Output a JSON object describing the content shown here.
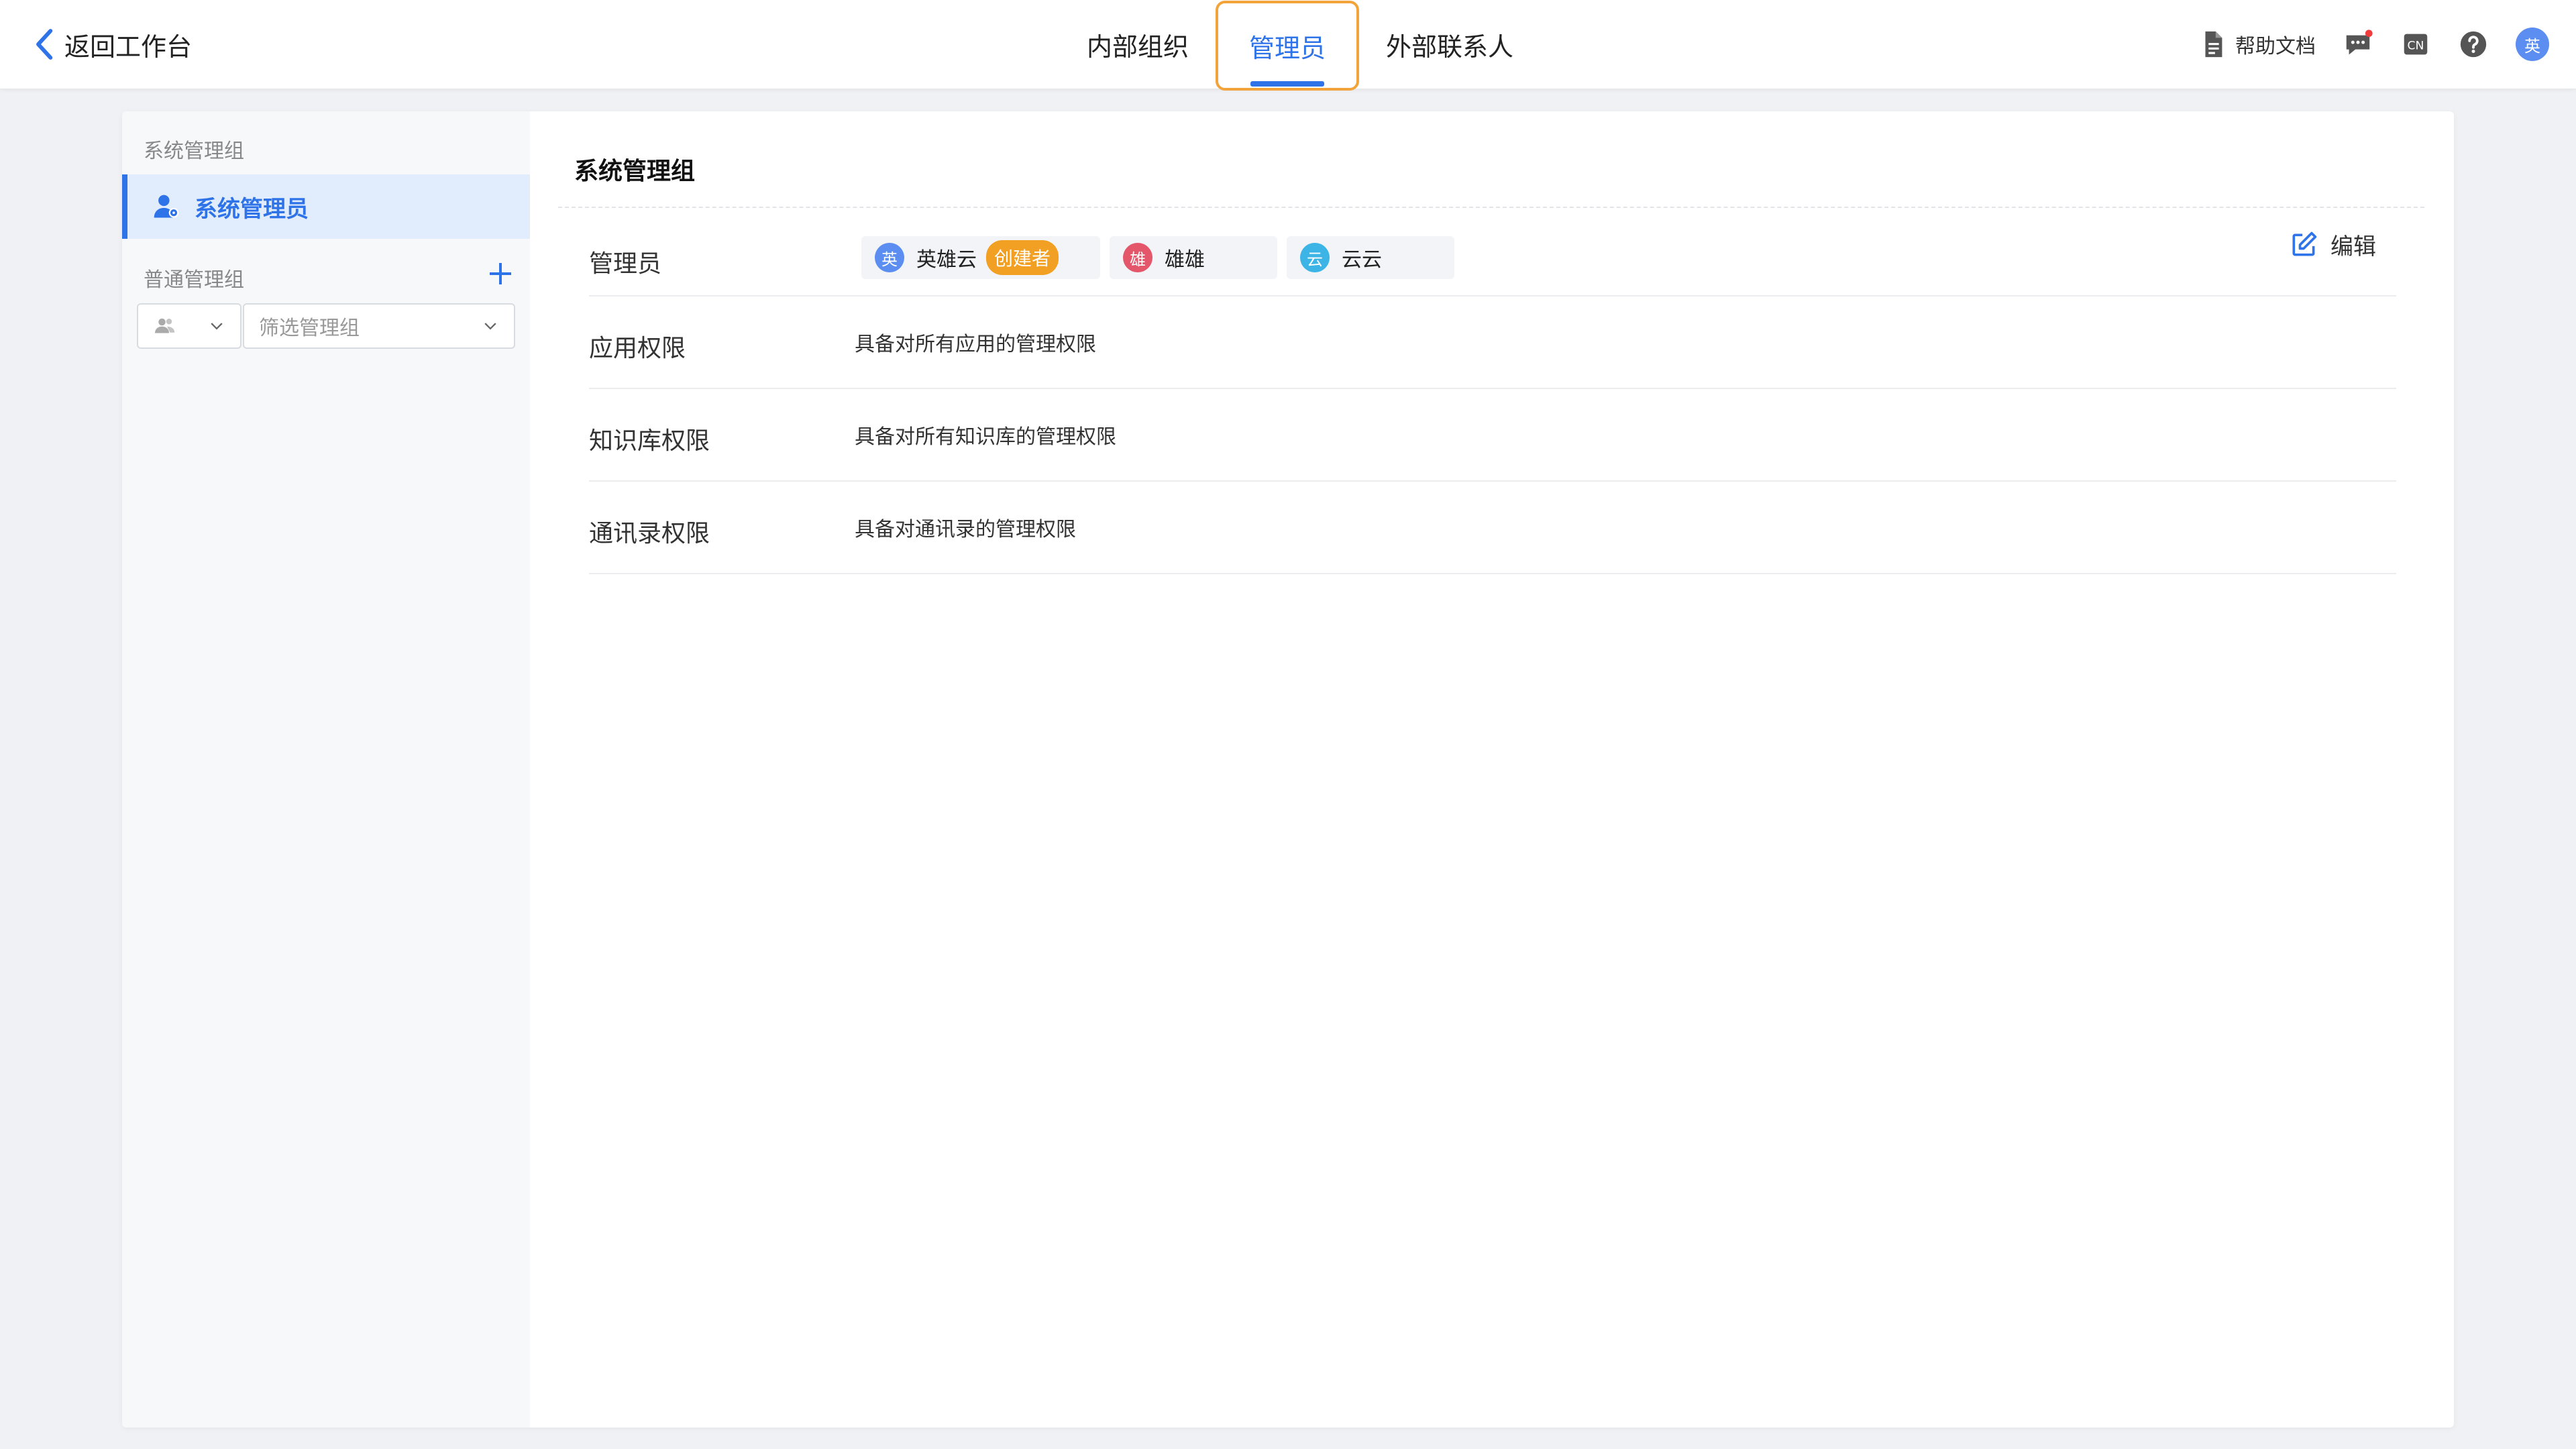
{
  "header": {
    "back_label": "返回工作台",
    "tabs": [
      {
        "label": "内部组织",
        "active": false
      },
      {
        "label": "管理员",
        "active": true
      },
      {
        "label": "外部联系人",
        "active": false
      }
    ],
    "help_label": "帮助文档",
    "lang_icon_text": "CN",
    "user_avatar_text": "英"
  },
  "sidebar": {
    "system_group_heading": "系统管理组",
    "active_item_label": "系统管理员",
    "normal_group_heading": "普通管理组",
    "filter_placeholder": "筛选管理组"
  },
  "main": {
    "title": "系统管理组",
    "edit_label": "编辑",
    "admins_label": "管理员",
    "admins": [
      {
        "avatar": "英",
        "name": "英雄云",
        "badge": "创建者",
        "color": "#5b8ef0"
      },
      {
        "avatar": "雄",
        "name": "雄雄",
        "badge": "",
        "color": "#e4566a"
      },
      {
        "avatar": "云",
        "name": "云云",
        "badge": "",
        "color": "#3db4e6"
      }
    ],
    "permissions": [
      {
        "label": "应用权限",
        "value": "具备对所有应用的管理权限"
      },
      {
        "label": "知识库权限",
        "value": "具备对所有知识库的管理权限"
      },
      {
        "label": "通讯录权限",
        "value": "具备对通讯录的管理权限"
      }
    ]
  },
  "colors": {
    "accent": "#2f73e8",
    "highlight": "#f2a33a",
    "badge": "#f2a024",
    "notify": "#f03c3c"
  }
}
